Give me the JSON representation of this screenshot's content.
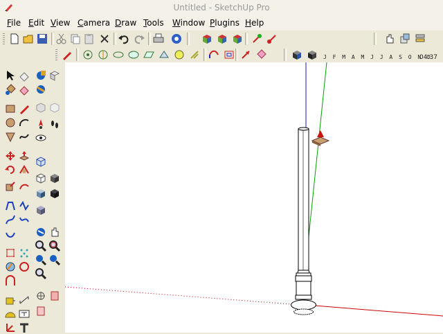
{
  "window": {
    "title": "Untitled - SketchUp Pro"
  },
  "menu": [
    {
      "first": "F",
      "rest": "ile"
    },
    {
      "first": "E",
      "rest": "dit"
    },
    {
      "first": "V",
      "rest": "iew"
    },
    {
      "first": "C",
      "rest": "amera"
    },
    {
      "first": "D",
      "rest": "raw"
    },
    {
      "first": "T",
      "rest": "ools"
    },
    {
      "first": "W",
      "rest": "indow"
    },
    {
      "first": "P",
      "rest": "lugins"
    },
    {
      "first": "H",
      "rest": "elp"
    }
  ],
  "shadow_bar": {
    "months": "J F M A M J J A S O N D",
    "time": "04:37"
  },
  "colors": {
    "xaxis": "#e00000",
    "yaxis": "#00a000",
    "zaxis": "#0000cc",
    "toolbar": "#ece9d8"
  }
}
